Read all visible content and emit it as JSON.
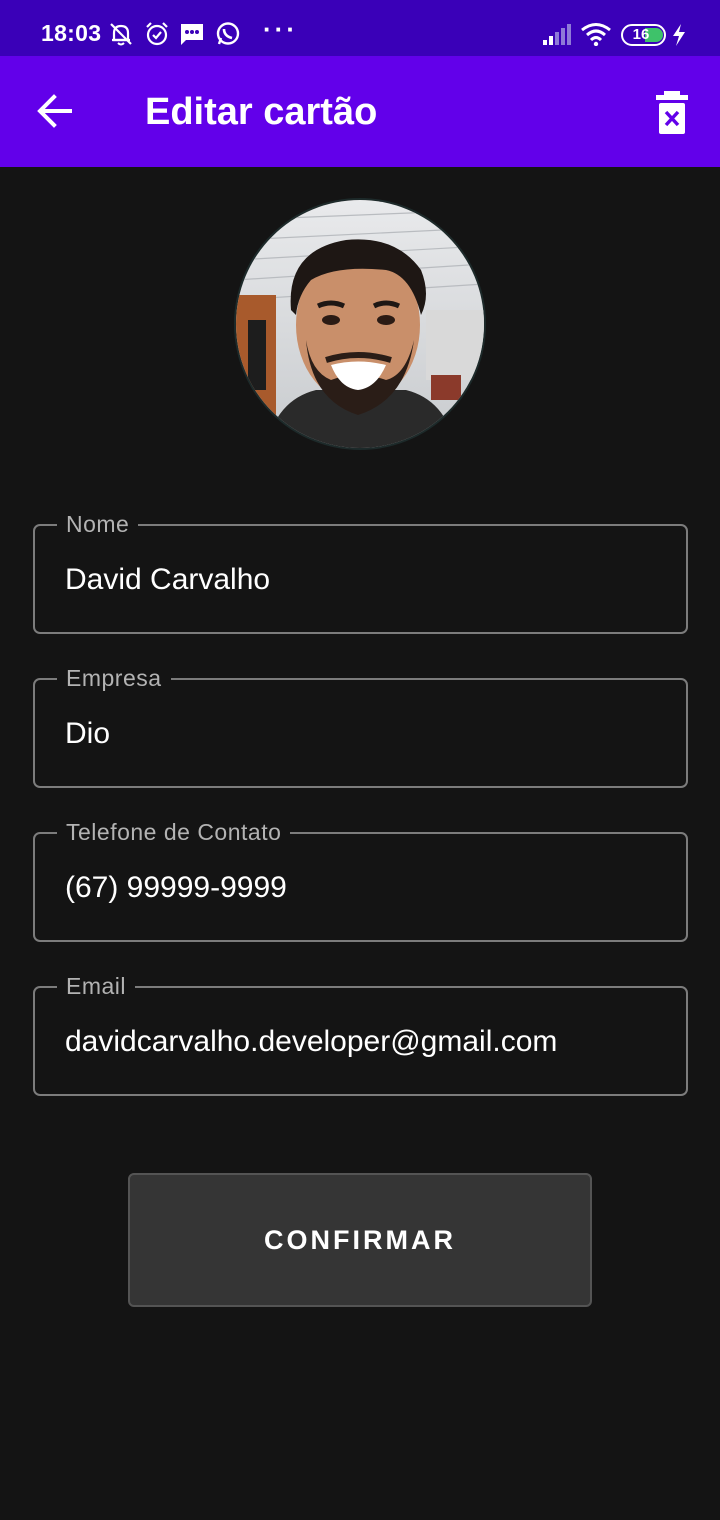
{
  "status_bar": {
    "time": "18:03",
    "more": "···",
    "battery": "16",
    "icons": [
      "muted-bell-icon",
      "alarm-icon",
      "message-icon",
      "whatsapp-icon",
      "signal-icon",
      "wifi-icon",
      "battery-icon",
      "charging-icon"
    ]
  },
  "app_bar": {
    "title": "Editar cartão",
    "back_icon": "arrow-back-icon",
    "delete_icon": "delete-icon",
    "color": "#6200ea"
  },
  "form": {
    "name": {
      "label": "Nome",
      "value": "David Carvalho"
    },
    "company": {
      "label": "Empresa",
      "value": "Dio"
    },
    "phone": {
      "label": "Telefone de Contato",
      "value": "(67) 99999-9999"
    },
    "email": {
      "label": "Email",
      "value": "davidcarvalho.developer@gmail.com"
    }
  },
  "confirm_button": {
    "label": "CONFIRMAR"
  },
  "colors": {
    "status_bar": "#3a00b8",
    "background": "#141414",
    "field_border": "#7c7c7c",
    "button": "#353535"
  }
}
